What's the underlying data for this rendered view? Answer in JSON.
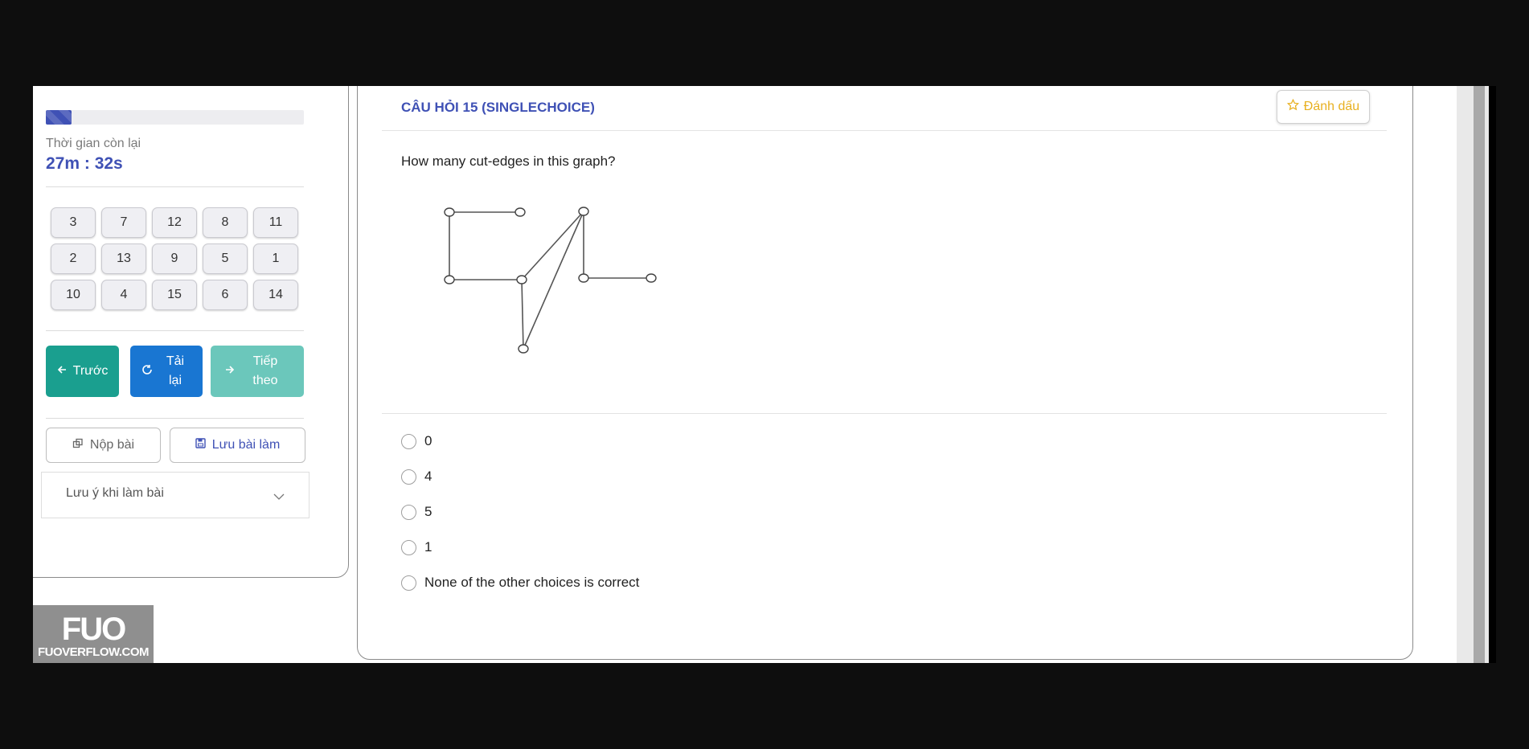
{
  "sidebar": {
    "progress_fraction": 0.1,
    "time_label": "Thời gian còn lại",
    "time_value": "27m : 32s",
    "question_numbers": [
      "3",
      "7",
      "12",
      "8",
      "11",
      "2",
      "13",
      "9",
      "5",
      "1",
      "10",
      "4",
      "15",
      "6",
      "14"
    ],
    "prev_label": "Trước",
    "reload_label": "Tải lại",
    "next_label": "Tiếp theo",
    "submit_label": "Nộp bài",
    "save_label": "Lưu bài làm",
    "notes_label": "Lưu ý khi làm bài"
  },
  "logo": {
    "mark": "FUO",
    "site": "FUOVERFLOW.COM"
  },
  "question": {
    "title": "CÂU HỎI 15 (SINGLECHOICE)",
    "mark_label": "Đánh dấu",
    "text": "How many cut-edges in this graph?",
    "options": [
      "0",
      "4",
      "5",
      "1",
      "None of the other choices is correct"
    ]
  },
  "colors": {
    "accent": "#3f51b5",
    "teal": "#1a9f8f",
    "blue": "#1976d2",
    "mark": "#e8b020"
  }
}
